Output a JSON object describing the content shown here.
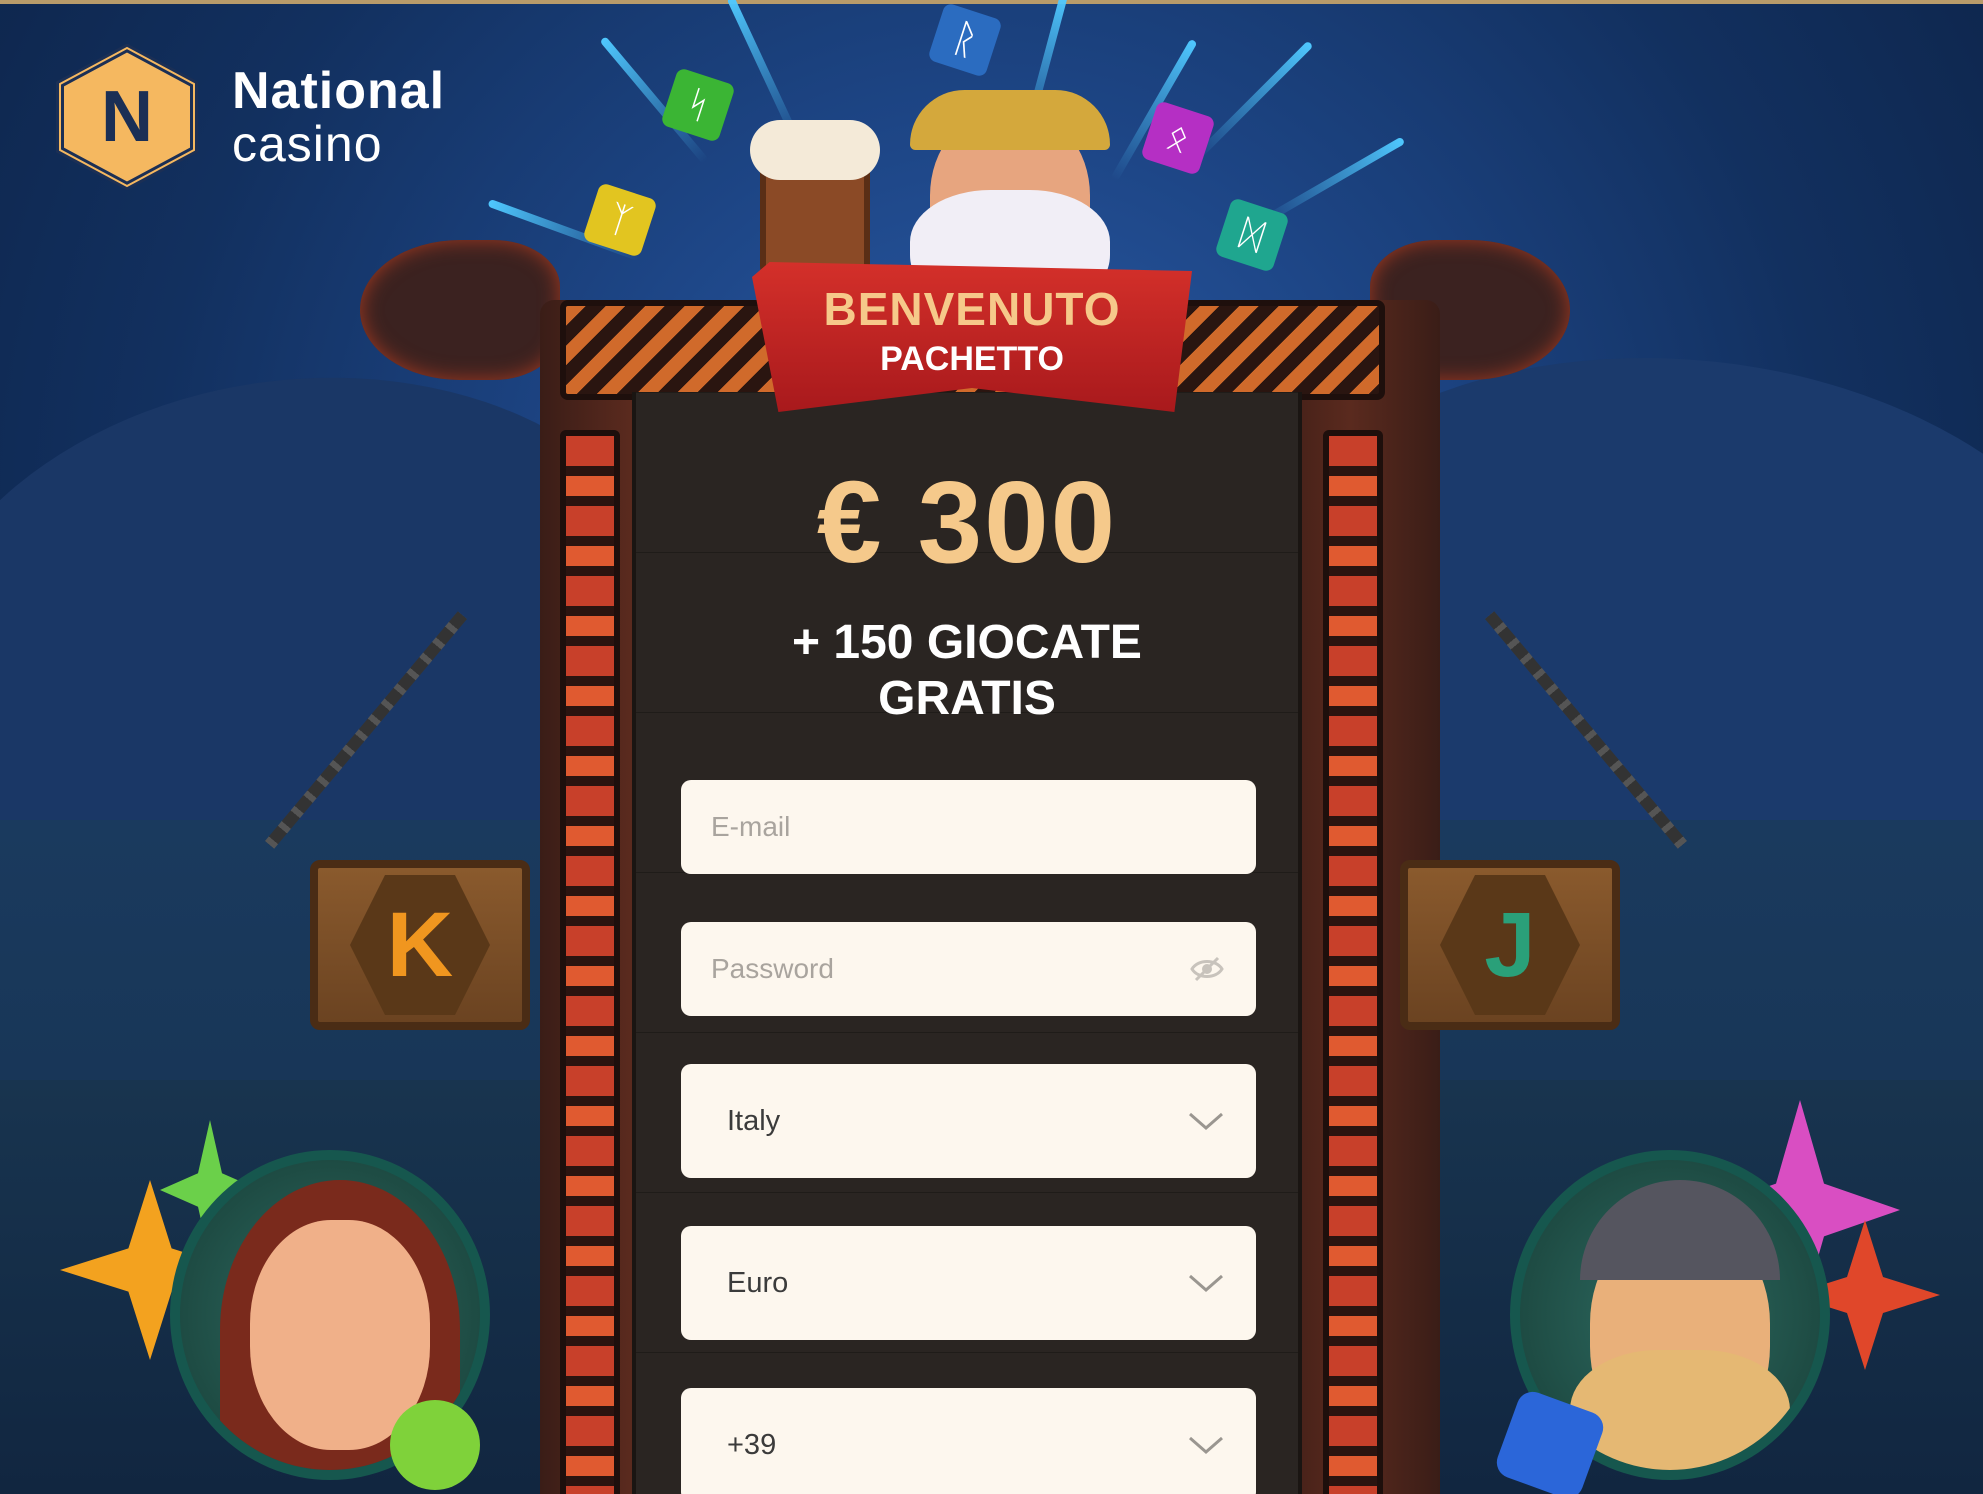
{
  "brand": {
    "logo_letter": "N",
    "name_line1": "National",
    "name_line2": "casino",
    "accent": "#f5b860"
  },
  "promo": {
    "ribbon_title": "BENVENUTO",
    "ribbon_subtitle": "PACHETTO",
    "amount": "€ 300",
    "spins_line1": "+ 150 GIOCATE",
    "spins_line2": "GRATIS"
  },
  "form": {
    "email_placeholder": "E-mail",
    "password_placeholder": "Password",
    "country_value": "Italy",
    "currency_value": "Euro",
    "phone_prefix_value": "+39"
  },
  "signs": {
    "left_letter": "K",
    "right_letter": "J"
  },
  "runes": {
    "top": "ᚱ",
    "green": "ᛋ",
    "yellow": "ᛉ",
    "pink": "ᛟ",
    "teal": "ᛞ"
  },
  "icons": {
    "password_toggle": "eye-slash-icon",
    "dropdown": "chevron-down-icon"
  },
  "colors": {
    "gold_text": "#f5c98b",
    "ribbon_red": "#c42226",
    "field_bg": "#fdf7ee",
    "panel_bg": "#2a2522"
  }
}
